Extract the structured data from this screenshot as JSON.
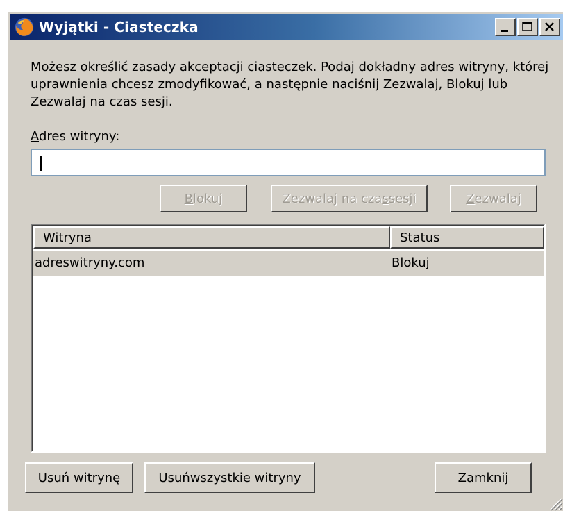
{
  "window": {
    "title": "Wyjątki - Ciasteczka",
    "controls": [
      "minimize-icon",
      "maximize-icon",
      "close-icon"
    ]
  },
  "description": "Możesz określić zasady akceptacji ciasteczek. Podaj dokładny adres witryny, której uprawnienia chcesz zmodyfikować, a następnie naciśnij Zezwalaj, Blokuj lub Zezwalaj na czas sesji.",
  "address": {
    "label_mnemonic": "A",
    "label_rest": "dres witryny:",
    "value": ""
  },
  "actions": {
    "block": {
      "pre": "",
      "mn": "B",
      "post": "lokuj"
    },
    "session": {
      "pre": "Zezwalaj na cza",
      "mn": "s",
      "post": " sesji"
    },
    "allow": {
      "pre": "",
      "mn": "Z",
      "post": "ezwalaj"
    }
  },
  "table": {
    "columns": [
      "Witryna",
      "Status"
    ],
    "rows": [
      {
        "site": "adreswitryny.com",
        "status": "Blokuj"
      }
    ]
  },
  "footer": {
    "remove_site": {
      "pre": "",
      "mn": "U",
      "post": "suń witrynę"
    },
    "remove_all": {
      "pre": "Usuń ",
      "mn": "w",
      "post": "szystkie witryny"
    },
    "close": {
      "pre": "Zam",
      "mn": "k",
      "post": "nij"
    }
  }
}
